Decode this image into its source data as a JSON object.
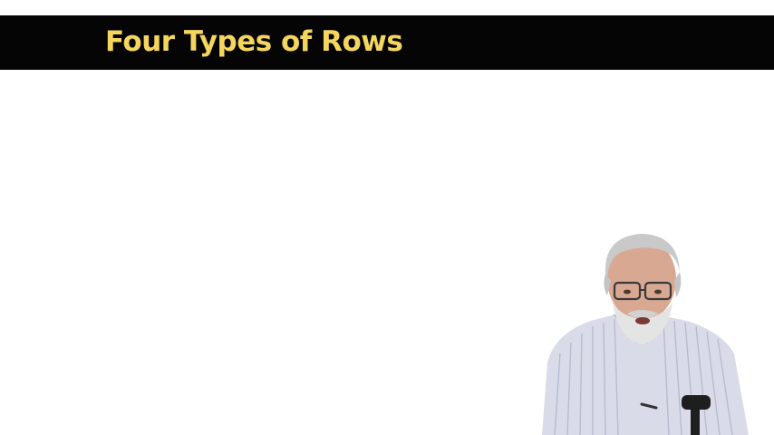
{
  "slide": {
    "title": "Four Types of Rows",
    "title_color": "#f4d65e",
    "title_bar_color": "#050505",
    "background_color": "#ffffff"
  },
  "presenter": {
    "description_icon": "presenter-video"
  }
}
